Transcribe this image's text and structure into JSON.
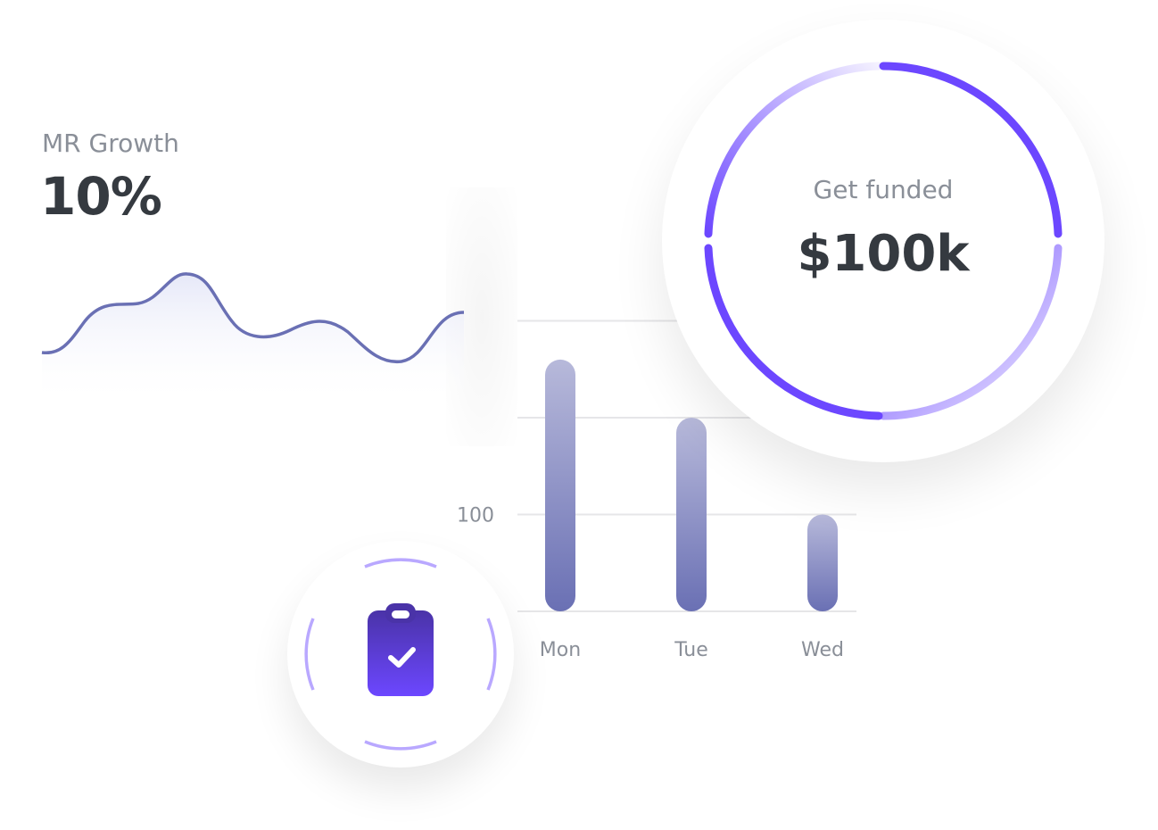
{
  "growth_card": {
    "label": "MR Growth",
    "value": "10%"
  },
  "funding_card": {
    "label": "Get funded",
    "value": "$100k",
    "accent": "#6c47ff"
  },
  "chart_data": {
    "type": "bar",
    "categories": [
      "Mon",
      "Tue",
      "Wed"
    ],
    "values": [
      260,
      200,
      100
    ],
    "ylim": [
      0,
      300
    ],
    "yticks_labeled": [
      "100"
    ],
    "grid": true,
    "bar_color": "#6a70b4"
  },
  "task_badge": {
    "icon": "clipboard-check-icon",
    "accent": "#6c47ff"
  }
}
